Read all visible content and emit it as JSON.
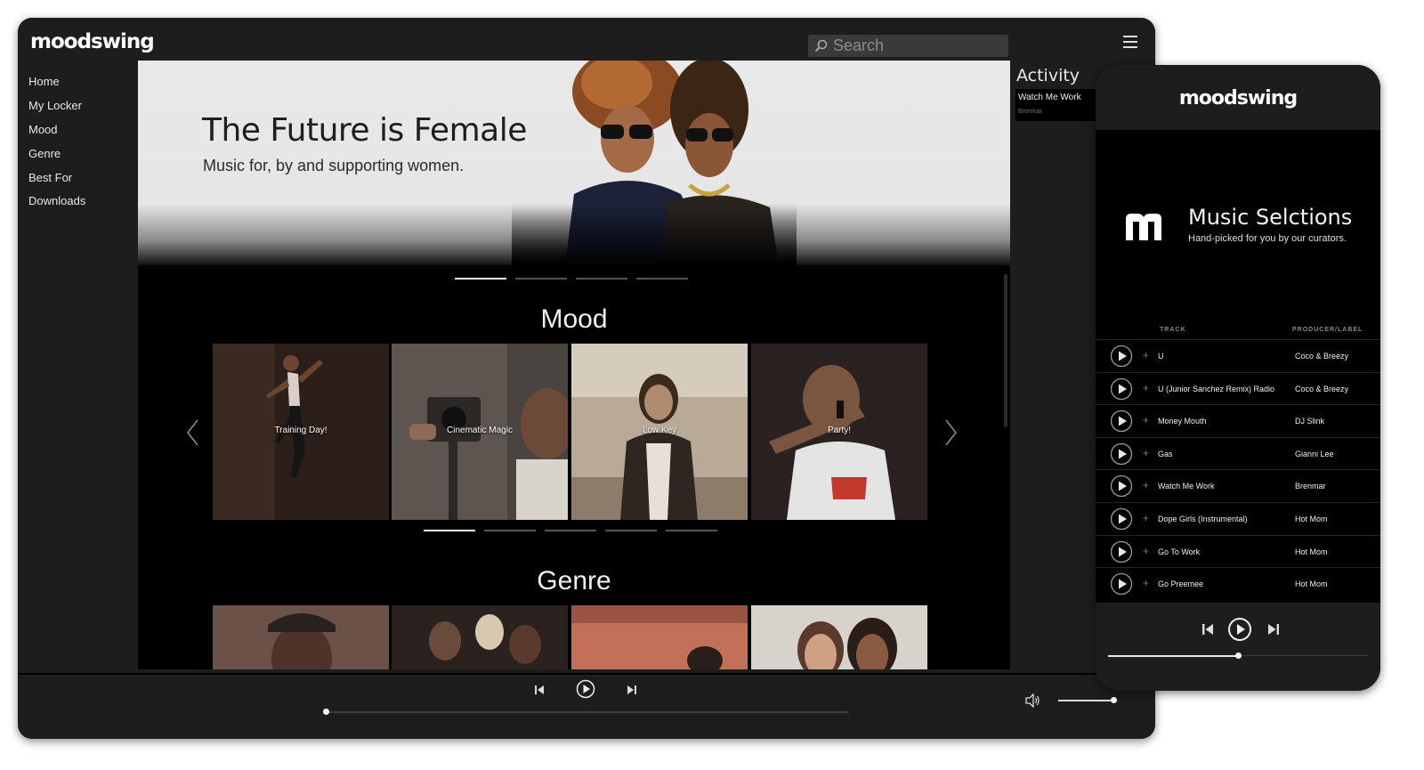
{
  "desktop": {
    "logo": "moodswing",
    "search": {
      "placeholder": "Search"
    },
    "nav": [
      "Home",
      "My Locker",
      "Mood",
      "Genre",
      "Best For",
      "Downloads"
    ],
    "hero": {
      "title": "The Future is Female",
      "subtitle": "Music for, by and supporting women.",
      "slide_count": 4,
      "active_slide": 0
    },
    "mood": {
      "title": "Mood",
      "tiles": [
        "Training Day!",
        "Cinematic Magic",
        "Low Key",
        "Party!"
      ],
      "page_count": 5,
      "active_page": 0
    },
    "genre": {
      "title": "Genre"
    },
    "activity": {
      "title": "Activity",
      "track": "Watch Me Work",
      "artist": "Brenmar"
    },
    "player": {
      "progress": 0.0,
      "volume": 1.0
    }
  },
  "phone": {
    "logo": "moodswing",
    "title": "Music Selctions",
    "subtitle": "Hand-picked for you by our curators.",
    "columns": {
      "track": "TRACK",
      "label": "PRODUCER/LABEL"
    },
    "tracks": [
      {
        "track": "U",
        "label": "Coco & Breezy"
      },
      {
        "track": "U (Junior Sanchez Remix) Radio",
        "label": "Coco & Breezy"
      },
      {
        "track": "Money Mouth",
        "label": "DJ Slink"
      },
      {
        "track": "Gas",
        "label": "Gianni Lee"
      },
      {
        "track": "Watch Me Work",
        "label": "Brenmar"
      },
      {
        "track": "Dope Girls (Instrumental)",
        "label": "Hot Mom"
      },
      {
        "track": "Go To Work",
        "label": "Hot Mom"
      },
      {
        "track": "Go Preemee",
        "label": "Hot Mom"
      }
    ],
    "player": {
      "progress": 0.5
    }
  },
  "colors": {
    "panel": "#1d1d1d",
    "background": "#000000",
    "text": "#ffffff"
  }
}
